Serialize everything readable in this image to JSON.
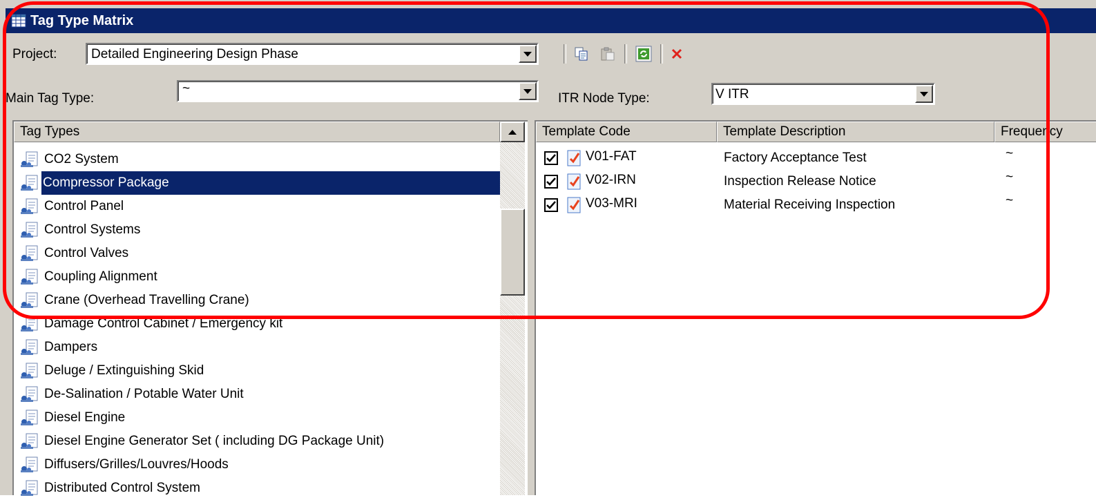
{
  "window": {
    "title": "Tag Type Matrix"
  },
  "project": {
    "label": "Project:",
    "value": "Detailed Engineering Design Phase"
  },
  "main_tag_type": {
    "label": "Main Tag Type:",
    "value": "~"
  },
  "itr_node_type": {
    "label": "ITR Node Type:",
    "value": "V ITR"
  },
  "toolbar": {
    "icons": [
      "copy-icon",
      "paste-icon",
      "refresh-icon",
      "delete-icon"
    ]
  },
  "tag_types": {
    "header": "Tag Types",
    "selected": "Compressor Package",
    "items": [
      "CO2 System",
      "Compressor Package",
      "Control Panel",
      "Control Systems",
      "Control Valves",
      "Coupling Alignment",
      "Crane (Overhead Travelling Crane)",
      "Damage Control Cabinet / Emergency kit",
      "Dampers",
      "Deluge / Extinguishing Skid",
      "De-Salination / Potable Water Unit",
      "Diesel Engine",
      "Diesel Engine Generator Set ( including DG Package Unit)",
      "Diffusers/Grilles/Louvres/Hoods",
      "Distributed Control System"
    ]
  },
  "templates": {
    "columns": [
      "Template Code",
      "Template Description",
      "Frequency"
    ],
    "rows": [
      {
        "code": "V01-FAT",
        "description": "Factory Acceptance Test",
        "frequency": "~",
        "checked": true
      },
      {
        "code": "V02-IRN",
        "description": "Inspection Release Notice",
        "frequency": "~",
        "checked": true
      },
      {
        "code": "V03-MRI",
        "description": "Material Receiving Inspection",
        "frequency": "~",
        "checked": true
      }
    ]
  },
  "colors": {
    "title_bar": "#0a246a",
    "selection": "#0a246a",
    "annotation": "#ff0000",
    "window_bg": "#d4d0c8"
  }
}
